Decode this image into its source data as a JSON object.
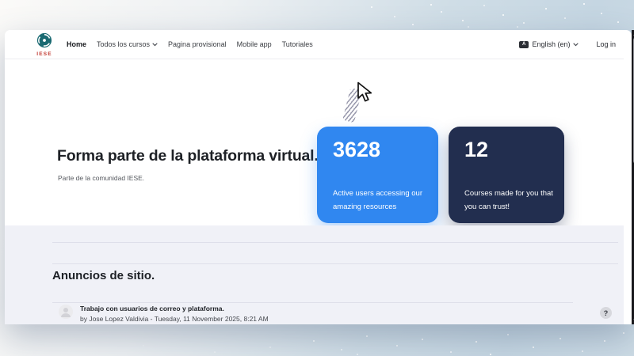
{
  "navbar": {
    "logo_text": "IESE",
    "items": [
      {
        "label": "Home"
      },
      {
        "label": "Todos los cursos"
      },
      {
        "label": "Pagina provisional"
      },
      {
        "label": "Mobile app"
      },
      {
        "label": "Tutoriales"
      }
    ],
    "language": {
      "icon": "language-icon",
      "icon_text": "A",
      "label": "English (en)"
    },
    "login_label": "Log in"
  },
  "hero": {
    "title": "Forma parte de la plataforma virtual.",
    "subtitle": "Parte de la comunidad IESE.",
    "stats": [
      {
        "value": "3628",
        "caption": "Active users accessing our amazing resources",
        "color": "#3087f0"
      },
      {
        "value": "12",
        "caption": "Courses made for you that you can trust!",
        "color": "#222e4f"
      }
    ]
  },
  "announcements": {
    "title": "Anuncios de sitio.",
    "items": [
      {
        "title": "Trabajo con usuarios de correo y plataforma.",
        "byline": "by Jose Lopez Valdivia - Tuesday, 11 November 2025, 8:21 AM"
      }
    ]
  },
  "help_label": "?",
  "colors": {
    "accent_blue": "#3087f0",
    "navy_card": "#222e4f",
    "logo_red": "#c13a32",
    "logo_teal": "#1a6a72",
    "section_bg": "#f0f1f7",
    "background_blue": "#c5d6e2",
    "scrollbar_track": "#19191d"
  }
}
